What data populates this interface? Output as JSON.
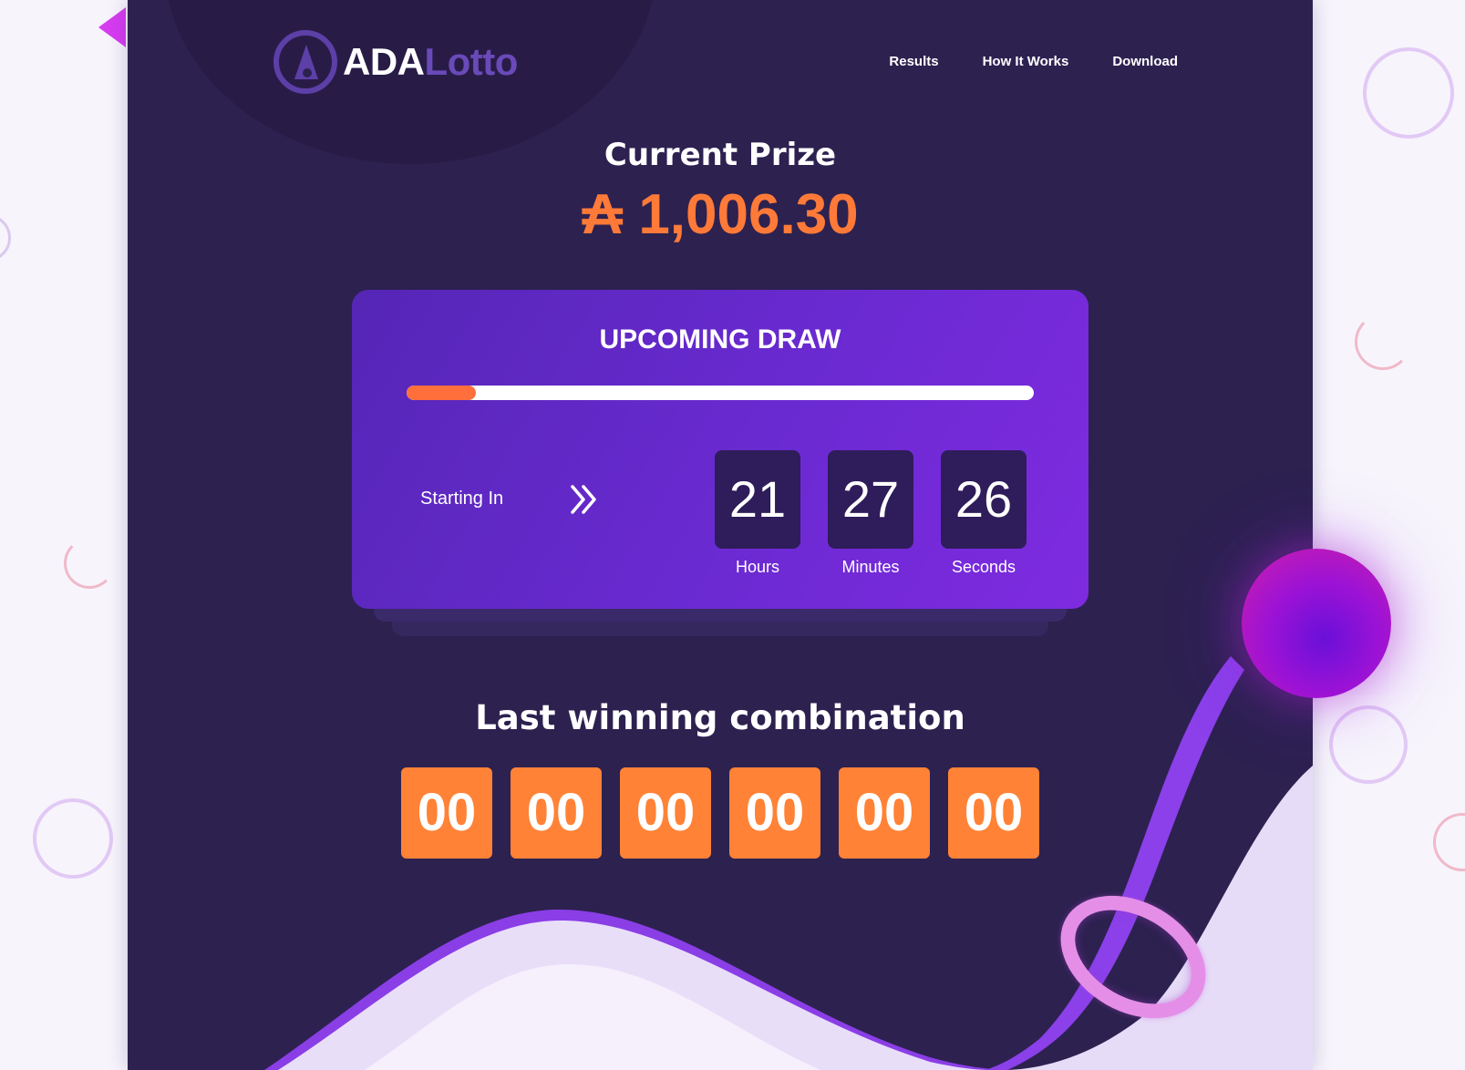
{
  "brand": {
    "name_primary": "ADA",
    "name_secondary": "Lotto",
    "logo_icon": "ada-logo-icon"
  },
  "nav": {
    "items": [
      "Results",
      "How It Works",
      "Download"
    ]
  },
  "prize": {
    "title": "Current Prize",
    "amount": "₳ 1,006.30"
  },
  "draw": {
    "title": "UPCOMING DRAW",
    "progress": 0.11,
    "starting_label": "Starting In",
    "starting_icon": "double-chevron-right-icon",
    "hours": {
      "value": "21",
      "label": "Hours"
    },
    "minutes": {
      "value": "27",
      "label": "Minutes"
    },
    "seconds": {
      "value": "26",
      "label": "Seconds"
    }
  },
  "last": {
    "title": "Last winning combination",
    "numbers": [
      "00",
      "00",
      "00",
      "00",
      "00",
      "00"
    ]
  },
  "colors": {
    "background": "#2d2150",
    "accent": "#ff7a38",
    "card": "#6a2ad1",
    "timer_box": "#2f1c5a"
  }
}
